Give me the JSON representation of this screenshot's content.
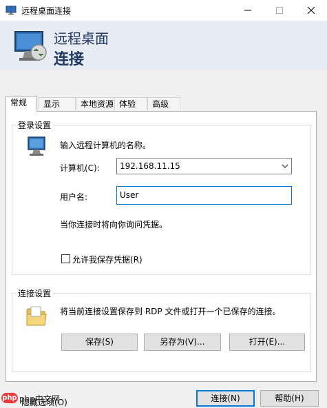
{
  "window": {
    "title": "远程桌面连接",
    "app_icon": "remote-desktop-icon",
    "controls": {
      "minimize": "minimize-icon",
      "maximize": "maximize-icon",
      "close": "close-icon"
    }
  },
  "header": {
    "line1": "远程桌面",
    "line2": "连接",
    "icon": "remote-desktop-icon"
  },
  "tabs": [
    {
      "label": "常规",
      "active": true
    },
    {
      "label": "显示",
      "active": false
    },
    {
      "label": "本地资源",
      "active": false
    },
    {
      "label": "体验",
      "active": false
    },
    {
      "label": "高级",
      "active": false
    }
  ],
  "login": {
    "group_label": "登录设置",
    "icon": "computer-icon",
    "instruction": "输入远程计算机的名称。",
    "computer_label": "计算机(C):",
    "computer_value": "192.168.11.15",
    "username_label": "用户名:",
    "username_value": "User",
    "credential_note": "当你连接时将向你询问凭据。",
    "save_credentials_label": "允许我保存凭据(R)",
    "save_credentials_checked": false
  },
  "connection": {
    "group_label": "连接设置",
    "icon": "folder-icon",
    "description": "将当前连接设置保存到 RDP 文件或打开一个已保存的连接。",
    "save_button": "保存(S)",
    "save_as_button": "另存为(V)...",
    "open_button": "打开(E)..."
  },
  "footer": {
    "options_label": "隐藏选项(O)",
    "connect_button": "连接(N)",
    "help_button": "帮助(H)"
  },
  "watermark": {
    "text": "php中文网",
    "badge": "php"
  },
  "colors": {
    "banner_bg": "#e8edf5",
    "heading": "#1f3864",
    "focus_border": "#0078d7"
  }
}
